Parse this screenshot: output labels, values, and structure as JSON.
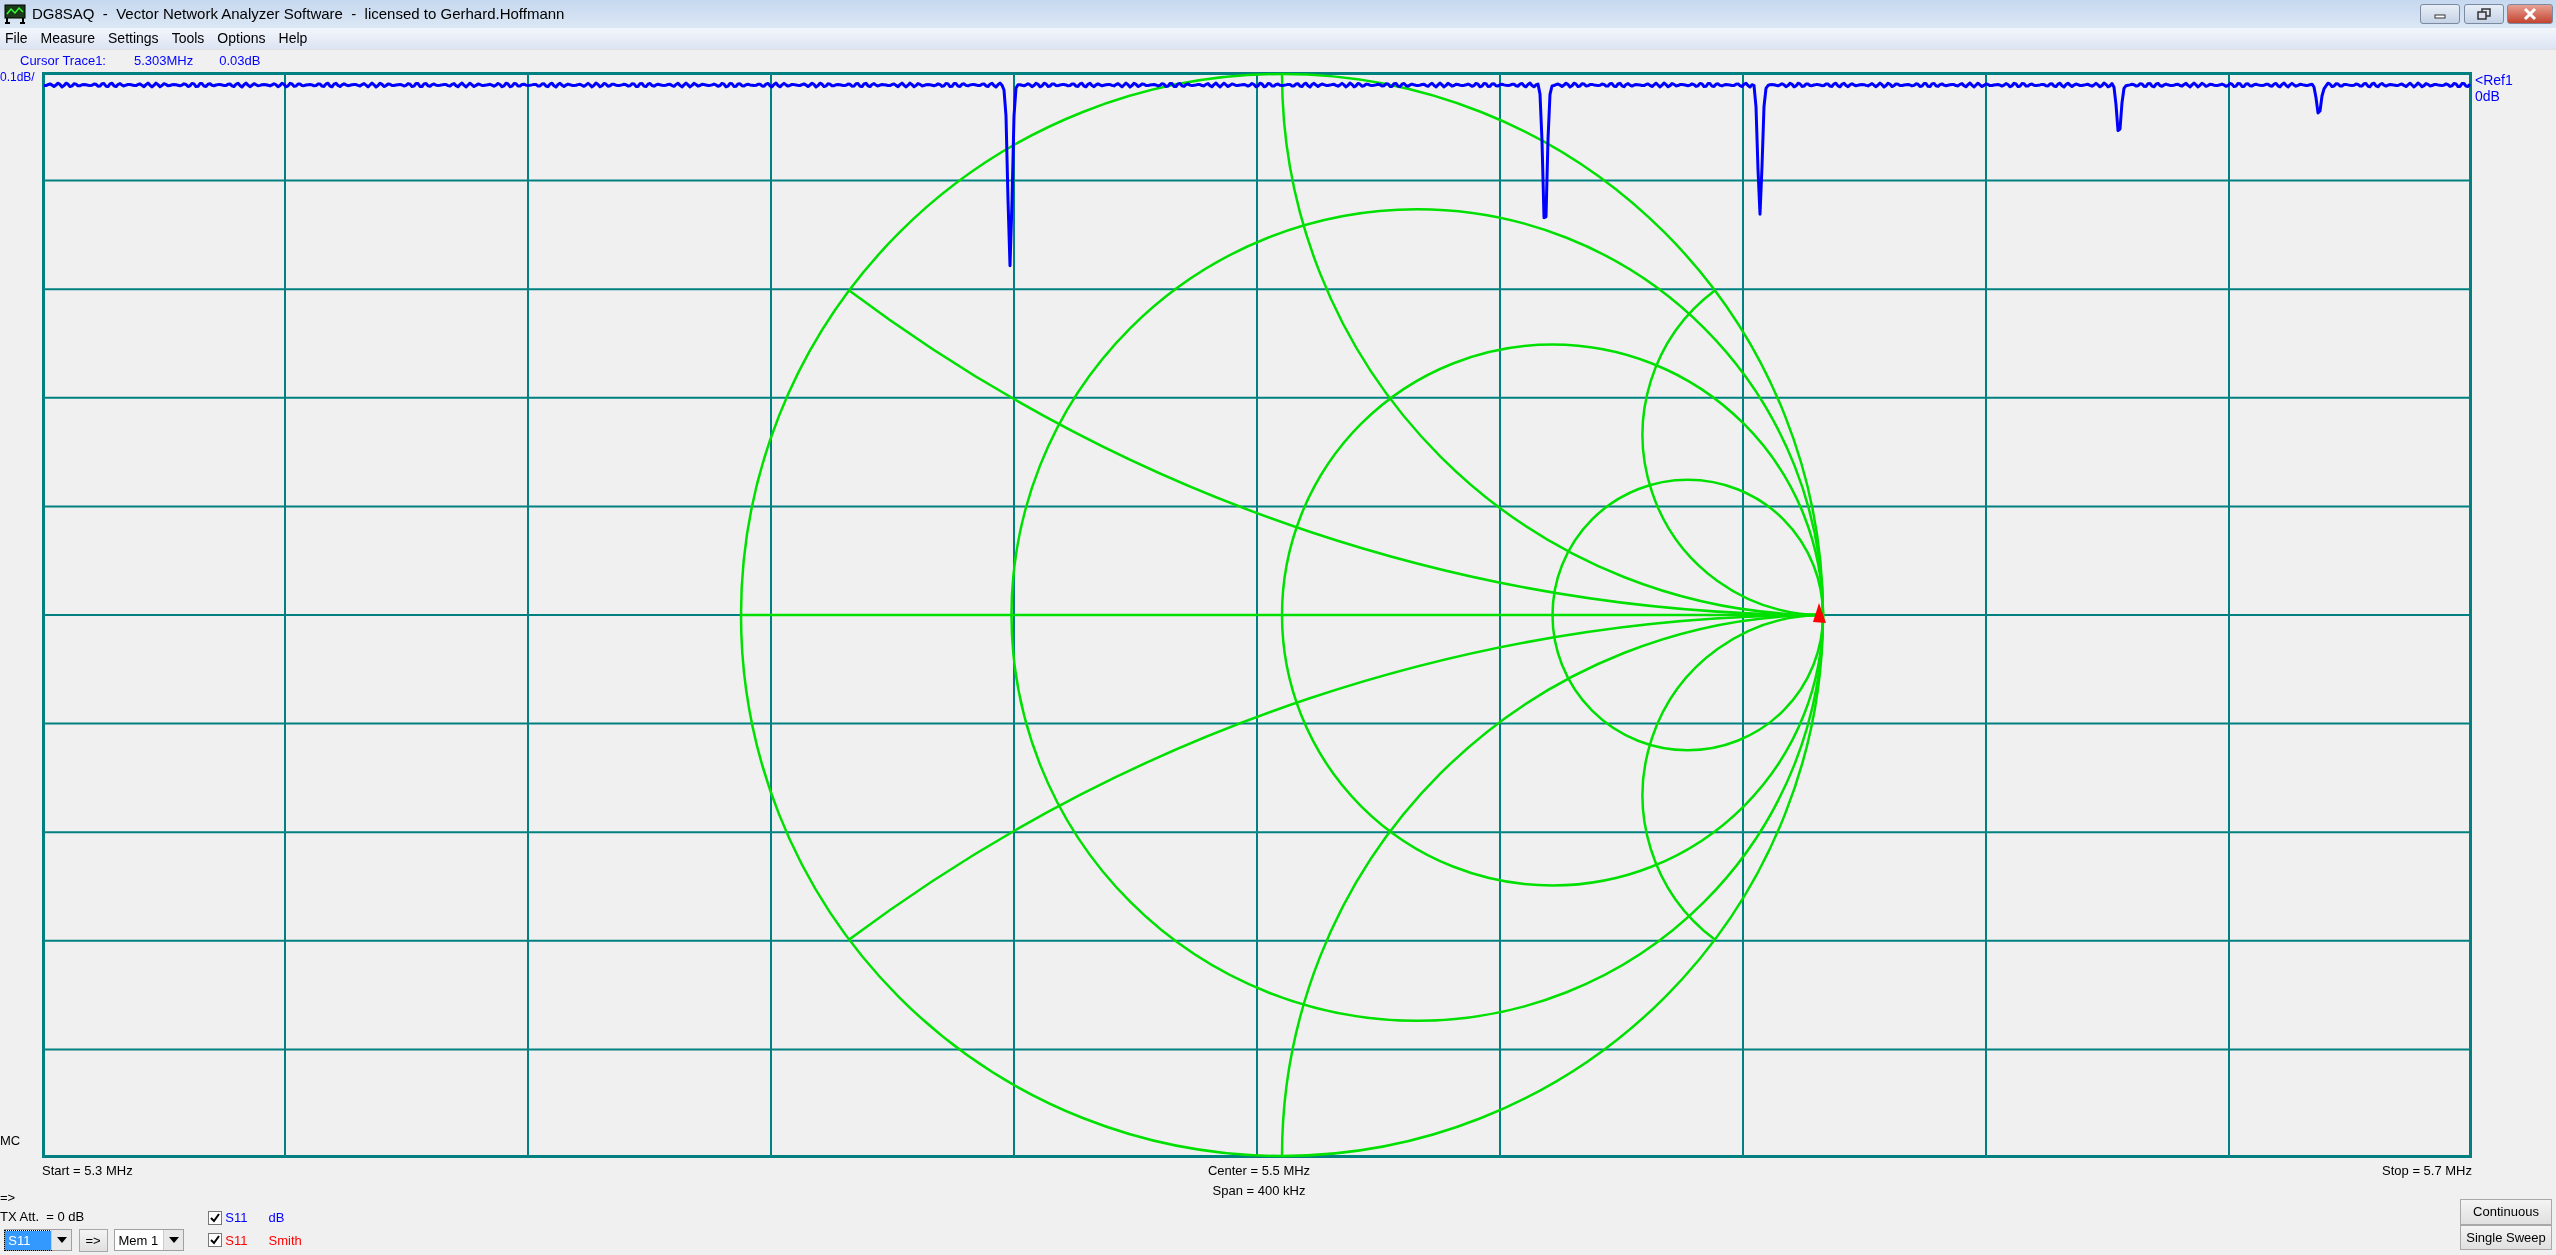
{
  "window": {
    "title": "DG8SAQ  -  Vector Network Analyzer Software  -  licensed to Gerhard.Hoffmann"
  },
  "menu": [
    {
      "label": "File"
    },
    {
      "label": "Measure"
    },
    {
      "label": "Settings"
    },
    {
      "label": "Tools"
    },
    {
      "label": "Options"
    },
    {
      "label": "Help"
    }
  ],
  "cursor": {
    "label": "Cursor Trace1:",
    "frequency": "5.303MHz",
    "value": "0.03dB"
  },
  "plot": {
    "scale_label": "0.1dB/",
    "ref_label": "<Ref1",
    "ref_value": "0dB",
    "corner_label": "MC",
    "start": "Start = 5.3 MHz",
    "center": "Center = 5.5 MHz",
    "span": "Span = 400 kHz",
    "stop": "Stop = 5.7 MHz"
  },
  "controls": {
    "arrow_label": "=>",
    "tx_att": "TX Att.  = 0 dB",
    "trace_select": "S11",
    "transfer_button": "=>",
    "memory_select": "Mem 1"
  },
  "traces": [
    {
      "name": "S11",
      "format": "dB",
      "checked": true,
      "color": "#0000ff"
    },
    {
      "name": "S11",
      "format": "Smith",
      "checked": true,
      "color": "#ff0000"
    }
  ],
  "buttons": [
    "Continuous",
    "Single Sweep"
  ]
}
